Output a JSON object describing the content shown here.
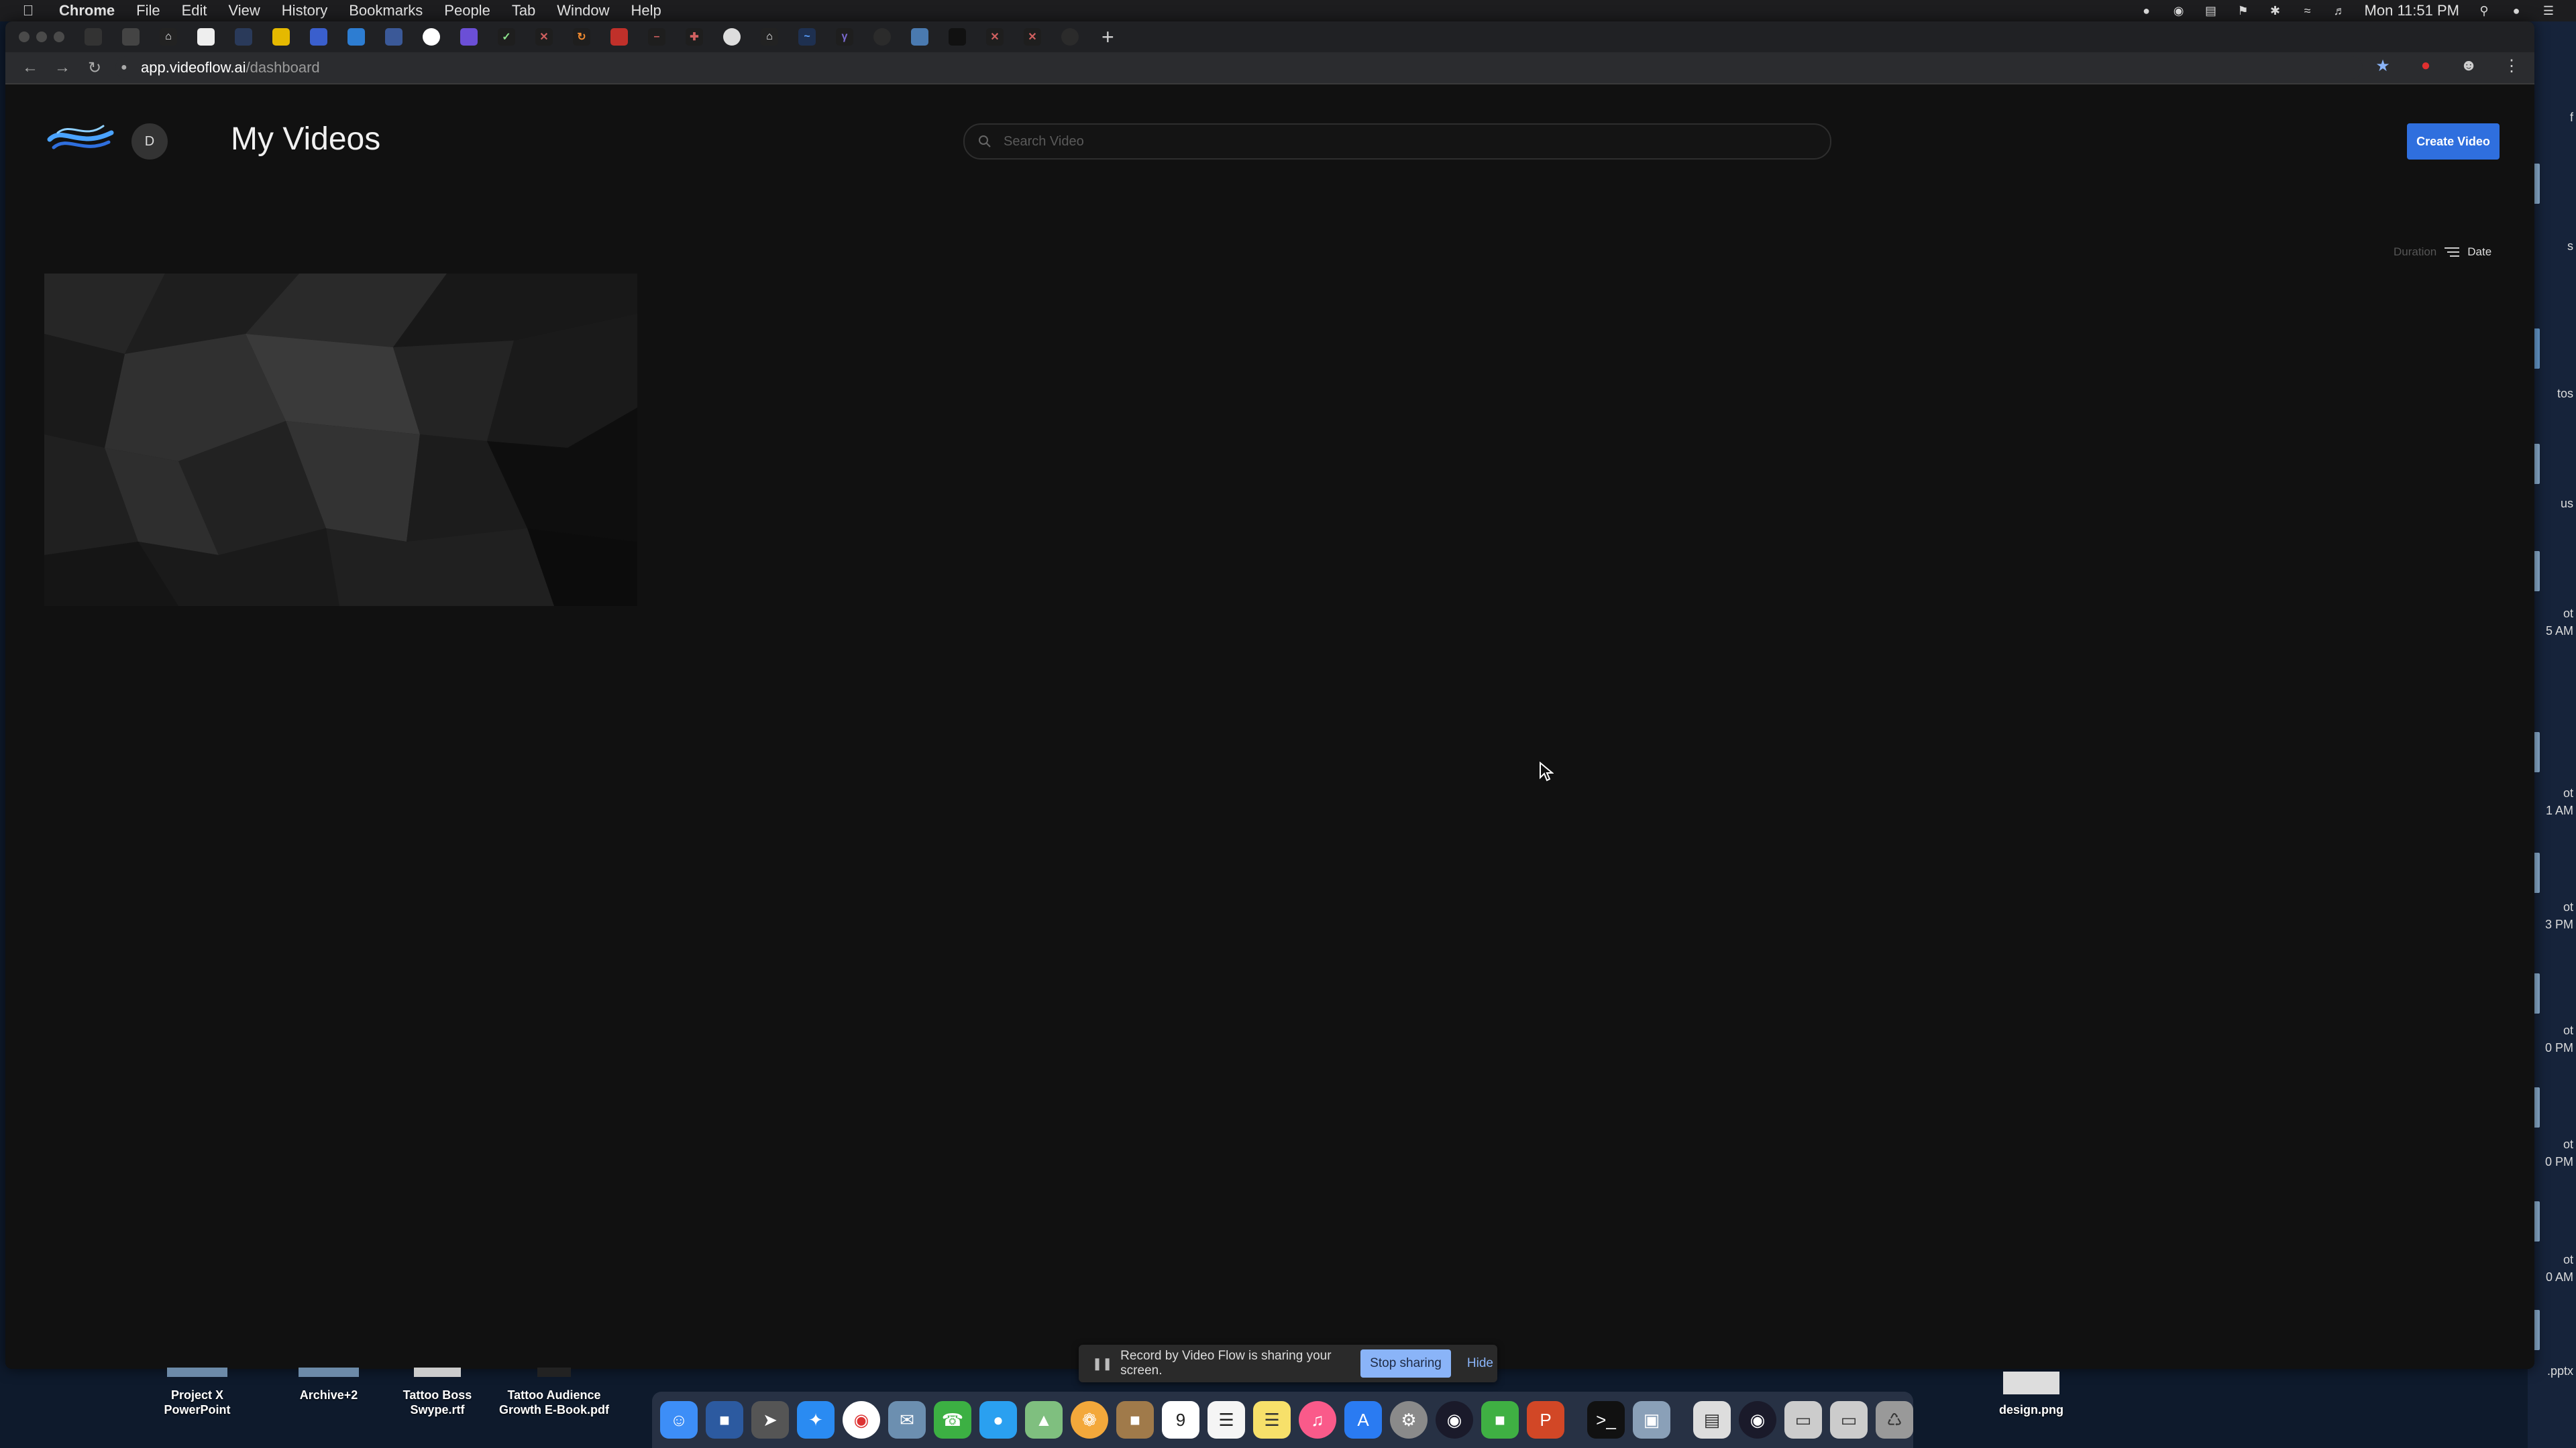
{
  "menubar": {
    "app_name": "Chrome",
    "items": [
      "File",
      "Edit",
      "View",
      "History",
      "Bookmarks",
      "People",
      "Tab",
      "Window",
      "Help"
    ],
    "clock": "Mon 11:51 PM"
  },
  "browser": {
    "url_domain": "app.videoflow.ai",
    "url_path": "/dashboard"
  },
  "app": {
    "avatar_initial": "D",
    "page_title": "My Videos",
    "search_placeholder": "Search Video",
    "create_button": "Create Video",
    "sort_duration": "Duration",
    "sort_date": "Date"
  },
  "share_bar": {
    "message": "Record by Video Flow is sharing your screen.",
    "stop_label": "Stop sharing",
    "hide_label": "Hide"
  },
  "desktop": {
    "files": [
      {
        "line1": "Project X",
        "line2": "PowerPoint"
      },
      {
        "line1": "Archive+2",
        "line2": ""
      },
      {
        "line1": "Tattoo Boss",
        "line2": "Swype.rtf"
      },
      {
        "line1": "Tattoo Audience",
        "line2": "Growth E-Book.pdf"
      },
      {
        "line1": "design.png",
        "line2": ""
      }
    ],
    "strip_labels": [
      "f",
      "s",
      "tos",
      "us",
      "ot",
      "5 AM",
      "ot",
      "1 AM",
      "ot",
      "3 PM",
      "ot",
      "0 PM",
      "ot",
      "0 PM",
      "ot",
      "0 AM",
      ".pptx"
    ]
  },
  "colors": {
    "accent": "#2f6fde",
    "app_background": "#111111",
    "share_button": "#8ab4f8"
  }
}
